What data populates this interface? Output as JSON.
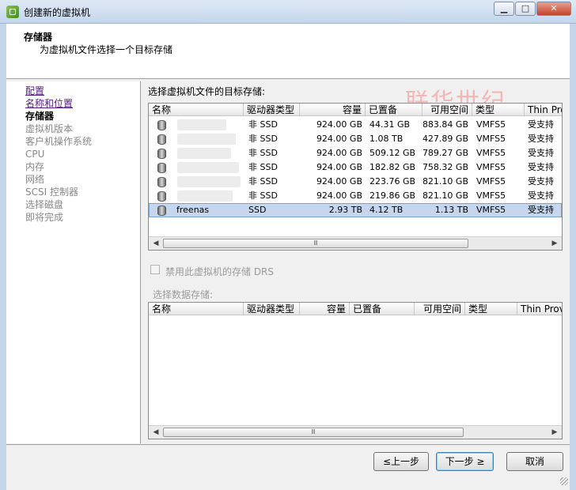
{
  "window": {
    "title": "创建新的虚拟机",
    "controls": {
      "minimize": "▁",
      "maximize": "□",
      "close": "✕"
    }
  },
  "header": {
    "title": "存储器",
    "subtitle": "为虚拟机文件选择一个目标存储"
  },
  "sidebar": {
    "items": [
      {
        "label": "配置",
        "state": "link"
      },
      {
        "label": "名称和位置",
        "state": "link"
      },
      {
        "label": "存储器",
        "state": "current"
      },
      {
        "label": "虚拟机版本",
        "state": "pending"
      },
      {
        "label": "客户机操作系统",
        "state": "pending"
      },
      {
        "label": "CPU",
        "state": "pending"
      },
      {
        "label": "内存",
        "state": "pending"
      },
      {
        "label": "网络",
        "state": "pending"
      },
      {
        "label": "SCSI 控制器",
        "state": "pending"
      },
      {
        "label": "选择磁盘",
        "state": "pending"
      },
      {
        "label": "即将完成",
        "state": "pending"
      }
    ]
  },
  "watermark": "联华世纪",
  "main": {
    "select_label": "选择虚拟机文件的目标存储:",
    "columns": [
      "名称",
      "驱动器类型",
      "容量",
      "已置备",
      "可用空间",
      "类型",
      "Thin Prov"
    ],
    "datastores": [
      {
        "name": "",
        "drive_type": "非 SSD",
        "capacity": "924.00 GB",
        "provisioned": "44.31 GB",
        "free": "883.84 GB",
        "type": "VMFS5",
        "thin": "受支持",
        "selected": false
      },
      {
        "name": "",
        "drive_type": "非 SSD",
        "capacity": "924.00 GB",
        "provisioned": "1.08 TB",
        "free": "427.89 GB",
        "type": "VMFS5",
        "thin": "受支持",
        "selected": false
      },
      {
        "name": "",
        "drive_type": "非 SSD",
        "capacity": "924.00 GB",
        "provisioned": "509.12 GB",
        "free": "789.27 GB",
        "type": "VMFS5",
        "thin": "受支持",
        "selected": false
      },
      {
        "name": "",
        "drive_type": "非 SSD",
        "capacity": "924.00 GB",
        "provisioned": "182.82 GB",
        "free": "758.32 GB",
        "type": "VMFS5",
        "thin": "受支持",
        "selected": false
      },
      {
        "name": "",
        "drive_type": "非 SSD",
        "capacity": "924.00 GB",
        "provisioned": "223.76 GB",
        "free": "821.10 GB",
        "type": "VMFS5",
        "thin": "受支持",
        "selected": false
      },
      {
        "name": "",
        "drive_type": "非 SSD",
        "capacity": "924.00 GB",
        "provisioned": "219.86 GB",
        "free": "821.10 GB",
        "type": "VMFS5",
        "thin": "受支持",
        "selected": false
      },
      {
        "name": "freenas",
        "drive_type": "SSD",
        "capacity": "2.93 TB",
        "provisioned": "4.12 TB",
        "free": "1.13 TB",
        "type": "VMFS5",
        "thin": "受支持",
        "selected": true
      }
    ],
    "drs_checkbox": {
      "label": "禁用此虚拟机的存储 DRS",
      "checked": false,
      "enabled": false
    },
    "ds_label": "选择数据存储:",
    "ds_columns": [
      "名称",
      "驱动器类型",
      "容量",
      "已置备",
      "可用空间",
      "类型",
      "Thin Provi"
    ]
  },
  "scroll": {
    "left": "◀",
    "right": "▶",
    "thumb": "Ⅲ"
  },
  "footer": {
    "back": "≤上一步",
    "next": "下一步 ≥",
    "cancel": "取消"
  }
}
